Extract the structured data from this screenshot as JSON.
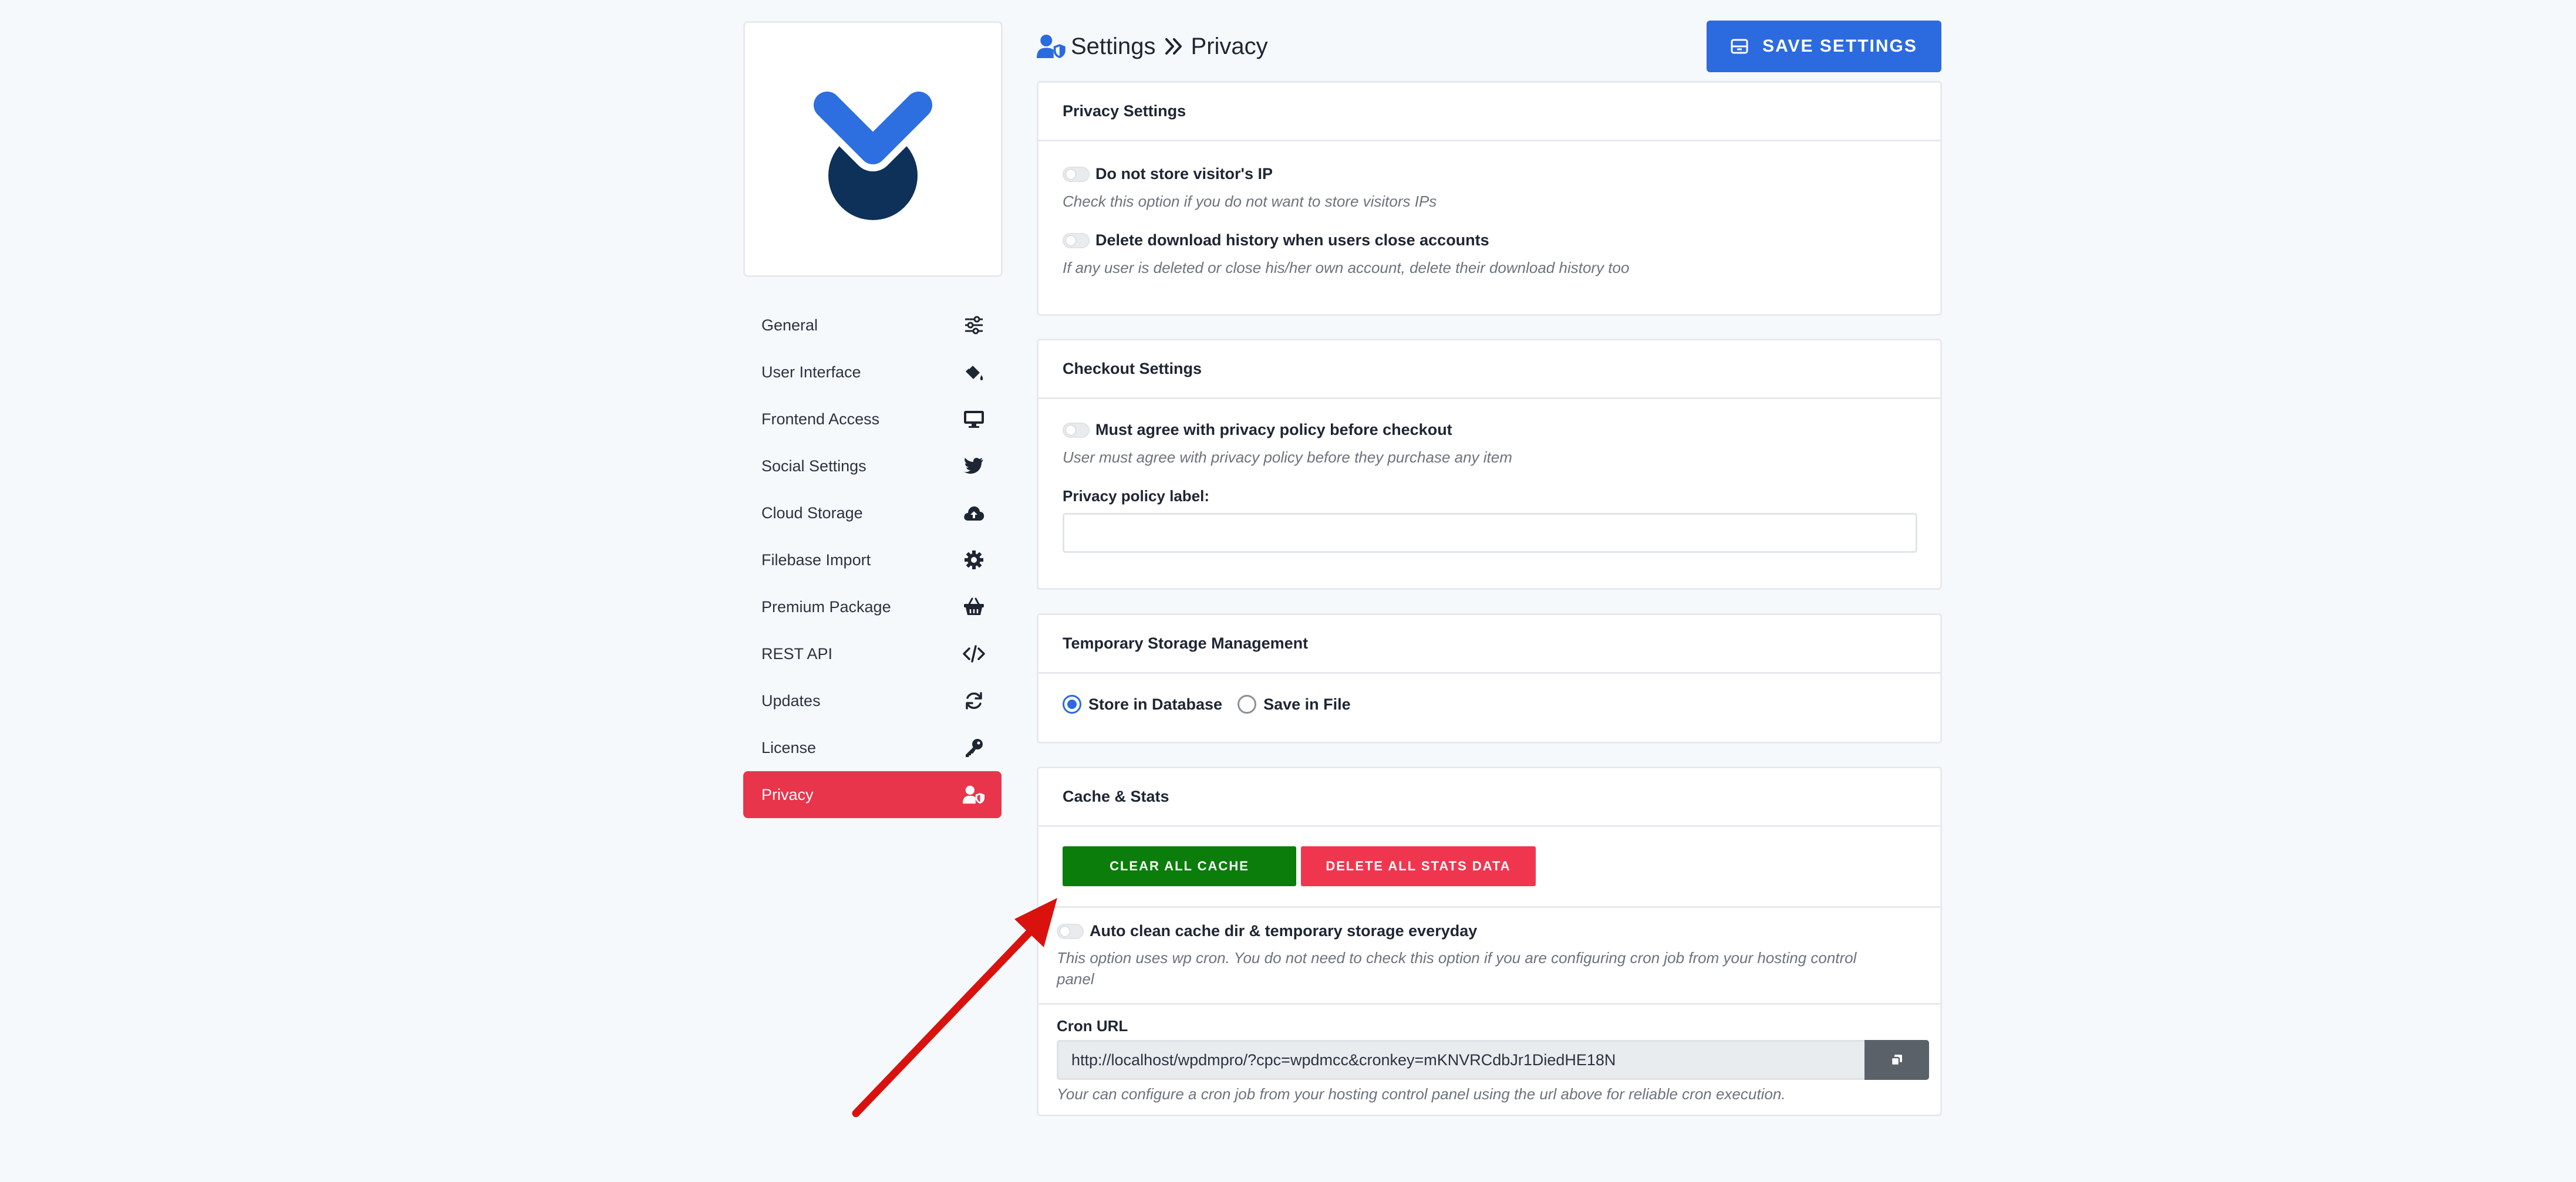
{
  "header": {
    "section": "Settings",
    "page": "Privacy",
    "save_label": "SAVE SETTINGS"
  },
  "sidebar": {
    "items": [
      {
        "label": "General",
        "icon": "sliders-icon"
      },
      {
        "label": "User Interface",
        "icon": "paint-bucket-icon"
      },
      {
        "label": "Frontend Access",
        "icon": "desktop-icon"
      },
      {
        "label": "Social Settings",
        "icon": "twitter-icon"
      },
      {
        "label": "Cloud Storage",
        "icon": "cloud-upload-icon"
      },
      {
        "label": "Filebase Import",
        "icon": "gear-icon"
      },
      {
        "label": "Premium Package",
        "icon": "basket-icon"
      },
      {
        "label": "REST API",
        "icon": "code-icon"
      },
      {
        "label": "Updates",
        "icon": "sync-icon"
      },
      {
        "label": "License",
        "icon": "key-icon"
      },
      {
        "label": "Privacy",
        "icon": "user-shield-icon",
        "active": true
      }
    ]
  },
  "privacy": {
    "title": "Privacy Settings",
    "opt1_label": "Do not store visitor's IP",
    "opt1_hint": "Check this option if you do not want to store visitors IPs",
    "opt2_label": "Delete download history when users close accounts",
    "opt2_hint": "If any user is deleted or close his/her own account, delete their download history too"
  },
  "checkout": {
    "title": "Checkout Settings",
    "opt_label": "Must agree with privacy policy before checkout",
    "opt_hint": "User must agree with privacy policy before they purchase any item",
    "field_label": "Privacy policy label:",
    "field_value": ""
  },
  "storage": {
    "title": "Temporary Storage Management",
    "options": [
      "Store in Database",
      "Save in File"
    ],
    "selected": "Store in Database"
  },
  "cache": {
    "title": "Cache & Stats",
    "clear_label": "CLEAR ALL CACHE",
    "delete_label": "DELETE ALL STATS DATA",
    "auto_label": "Auto clean cache dir & temporary storage everyday",
    "auto_hint_line1": "This option uses wp cron. You do not need to check this option if you are configuring cron job from your hosting control",
    "auto_hint_line2": "panel",
    "cron_label": "Cron URL",
    "cron_url": "http://localhost/wpdmpro/?cpc=wpdmcc&cronkey=mKNVRCdbJr1DiedHE18N",
    "cron_hint": "Your can configure a cron job from your hosting control panel using the url above for reliable cron execution."
  },
  "colors": {
    "accent": "#2c6ae0",
    "active_nav": "#e8354b",
    "clear_cache": "#0b7d0b",
    "delete_stats": "#f0364e",
    "annotation_arrow": "#d9120e"
  }
}
